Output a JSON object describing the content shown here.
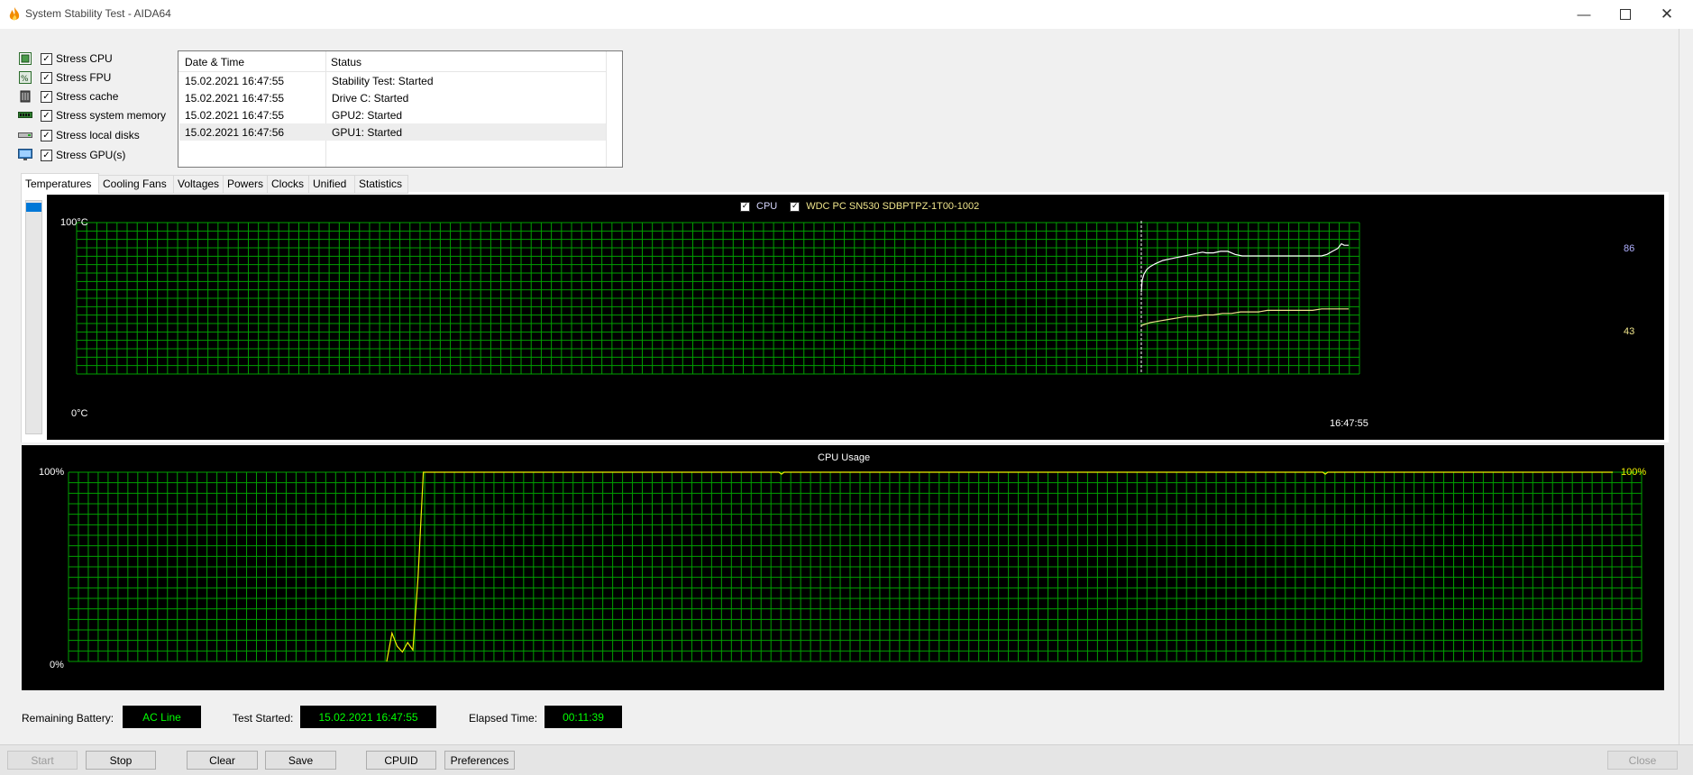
{
  "window": {
    "title": "System Stability Test - AIDA64",
    "minimize_icon": "minimize-icon",
    "maximize_icon": "maximize-icon",
    "close_icon": "close-icon"
  },
  "stress_options": [
    {
      "label": "Stress CPU",
      "checked": true,
      "icon": "cpu-icon"
    },
    {
      "label": "Stress FPU",
      "checked": true,
      "icon": "fpu-icon"
    },
    {
      "label": "Stress cache",
      "checked": true,
      "icon": "cache-icon"
    },
    {
      "label": "Stress system memory",
      "checked": true,
      "icon": "memory-icon"
    },
    {
      "label": "Stress local disks",
      "checked": true,
      "icon": "disk-icon"
    },
    {
      "label": "Stress GPU(s)",
      "checked": true,
      "icon": "gpu-icon"
    }
  ],
  "log": {
    "columns": [
      "Date & Time",
      "Status"
    ],
    "rows": [
      [
        "15.02.2021 16:47:55",
        "Stability Test: Started"
      ],
      [
        "15.02.2021 16:47:55",
        "Drive C: Started"
      ],
      [
        "15.02.2021 16:47:55",
        "GPU2: Started"
      ],
      [
        "15.02.2021 16:47:56",
        "GPU1: Started"
      ]
    ]
  },
  "tabs": [
    "Temperatures",
    "Cooling Fans",
    "Voltages",
    "Powers",
    "Clocks",
    "Unified",
    "Statistics"
  ],
  "active_tab": "Temperatures",
  "temperature_graph": {
    "legend": [
      {
        "label": "CPU",
        "checked": true,
        "color": "#ffffff"
      },
      {
        "label": "WDC PC SN530 SDBPTPZ-1T00-1002",
        "checked": true,
        "color": "#f0e68c"
      }
    ],
    "y_max_label": "100°C",
    "y_min_label": "0°C",
    "time_label": "16:47:55",
    "cpu_value_label": "86",
    "disk_value_label": "43",
    "grid_color": "#00a000"
  },
  "usage_graph": {
    "title": "CPU Usage",
    "y_max_label": "100%",
    "y_min_label": "0%",
    "value_label": "100%",
    "grid_color": "#00a000"
  },
  "chart_data": [
    {
      "type": "line",
      "ylim": [
        0,
        100
      ],
      "series": [
        {
          "name": "CPU",
          "color": "#ffffff",
          "t": [
            0,
            1,
            3,
            6,
            10,
            16,
            24,
            32,
            40,
            48,
            56,
            64,
            68,
            72,
            80,
            88,
            96,
            104,
            112,
            120,
            130,
            140,
            150,
            160,
            170,
            180,
            190,
            200,
            206,
            212,
            218,
            222,
            225,
            230
          ],
          "values": [
            54,
            62,
            66,
            69,
            71,
            73,
            75,
            76,
            77,
            78,
            79,
            80,
            80.5,
            80,
            80,
            81,
            81,
            79,
            78,
            78,
            78,
            78,
            78,
            78,
            78,
            78,
            78,
            78,
            79,
            81,
            83,
            86,
            85,
            85
          ]
        },
        {
          "name": "WDC PC SN530 SDBPTPZ-1T00-1002",
          "color": "#f0e68c",
          "t": [
            0,
            10,
            20,
            30,
            40,
            50,
            60,
            70,
            80,
            90,
            100,
            110,
            120,
            130,
            140,
            150,
            160,
            170,
            180,
            190,
            200,
            210,
            220,
            230
          ],
          "values": [
            32,
            34,
            35,
            36,
            37,
            38,
            38,
            39,
            39,
            40,
            40,
            41,
            41,
            41,
            42,
            42,
            42,
            42,
            42,
            42,
            43,
            43,
            43,
            43
          ]
        }
      ]
    },
    {
      "type": "line",
      "title": "CPU Usage",
      "ylim": [
        0,
        100
      ],
      "series": [
        {
          "name": "",
          "color": "#f0f000",
          "t": [
            0,
            2,
            4,
            6,
            8,
            10,
            12,
            14,
            16,
            18,
            22,
            24,
            30,
            60,
            120,
            150,
            151,
            152,
            200,
            300,
            358,
            359,
            360,
            420,
            469
          ],
          "values": [
            0,
            15,
            8,
            5,
            10,
            6,
            45,
            100,
            100,
            100,
            100,
            100,
            100,
            100,
            100,
            100,
            99,
            100,
            100,
            100,
            100,
            99,
            100,
            100,
            100
          ]
        }
      ]
    }
  ],
  "status_bar": {
    "battery_label": "Remaining Battery:",
    "battery_value": "AC Line",
    "started_label": "Test Started:",
    "started_value": "15.02.2021 16:47:55",
    "elapsed_label": "Elapsed Time:",
    "elapsed_value": "00:11:39"
  },
  "buttons": {
    "start": "Start",
    "stop": "Stop",
    "clear": "Clear",
    "save": "Save",
    "cpuid": "CPUID",
    "preferences": "Preferences",
    "close": "Close"
  }
}
